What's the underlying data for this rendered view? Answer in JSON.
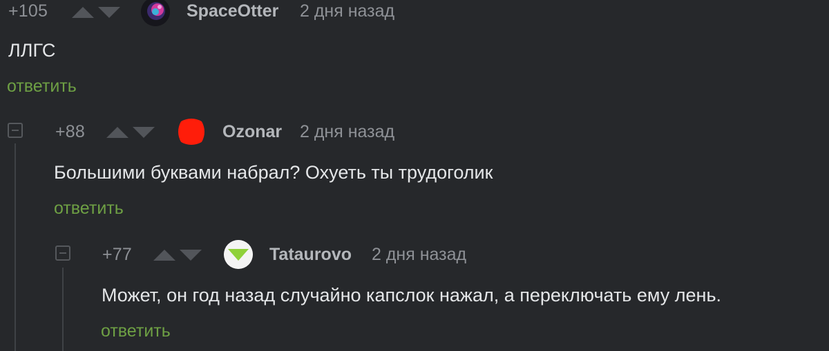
{
  "comments": [
    {
      "rating": "+105",
      "username": "SpaceOtter",
      "time": "2 дня назад",
      "text": "ЛЛГС",
      "reply_label": "ответить",
      "avatar_icon": "space-otter-avatar-icon"
    },
    {
      "rating": "+88",
      "username": "Ozonar",
      "time": "2 дня назад",
      "text": "Большими буквами набрал? Охуеть ты трудоголик",
      "reply_label": "ответить",
      "avatar_icon": "red-blob-avatar-icon"
    },
    {
      "rating": "+77",
      "username": "Tataurovo",
      "time": "2 дня назад",
      "text": "Может, он год назад случайно капслок нажал, а переключать ему лень.",
      "reply_label": "ответить",
      "avatar_icon": "green-triangle-avatar-icon"
    }
  ],
  "colors": {
    "background": "#26282b",
    "reply_link": "#6ea044",
    "username": "#b4b7bb",
    "meta": "#8e9196",
    "text": "#e4e6e8"
  }
}
